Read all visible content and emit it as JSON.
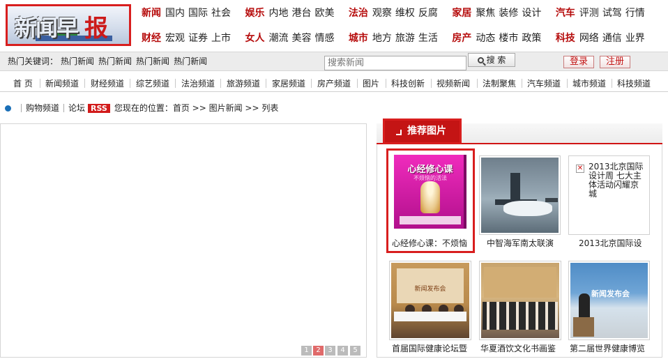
{
  "logo": {
    "text_a": "新闻早",
    "text_b": "报"
  },
  "nav_rows": [
    [
      {
        "cat": "新闻",
        "items": [
          "国内",
          "国际",
          "社会"
        ]
      },
      {
        "cat": "娱乐",
        "items": [
          "内地",
          "港台",
          "欧美"
        ]
      },
      {
        "cat": "法治",
        "items": [
          "观察",
          "维权",
          "反腐"
        ]
      },
      {
        "cat": "家居",
        "items": [
          "聚焦",
          "装修",
          "设计"
        ]
      },
      {
        "cat": "汽车",
        "items": [
          "评测",
          "试驾",
          "行情"
        ]
      }
    ],
    [
      {
        "cat": "财经",
        "items": [
          "宏观",
          "证券",
          "上市"
        ]
      },
      {
        "cat": "女人",
        "items": [
          "潮流",
          "美容",
          "情感"
        ]
      },
      {
        "cat": "城市",
        "items": [
          "地方",
          "旅游",
          "生活"
        ]
      },
      {
        "cat": "房产",
        "items": [
          "动态",
          "楼市",
          "政策"
        ]
      },
      {
        "cat": "科技",
        "items": [
          "网络",
          "通信",
          "业界"
        ]
      }
    ]
  ],
  "search": {
    "hot_label": "热门关键词：",
    "hot_keywords": [
      "热门新闻",
      "热门新闻",
      "热门新闻",
      "热门新闻"
    ],
    "placeholder": "搜索新闻",
    "button_label": "搜 索",
    "login_label": "登录",
    "register_label": "注册"
  },
  "channels": [
    "首 页",
    "新闻频道",
    "财经频道",
    "综艺频道",
    "法治频道",
    "旅游频道",
    "家居频道",
    "房产频道",
    "图片",
    "科技创新",
    "视频新闻",
    "法制聚焦",
    "汽车频道",
    "城市频道",
    "科技频道"
  ],
  "breadcrumb": {
    "shop_link": "购物频道",
    "forum_link": "论坛",
    "rss_label": "RSS",
    "location_text": "您现在的位置：首页 >> 图片新闻 >> 列表"
  },
  "pagination": [
    "1",
    "2",
    "3",
    "4",
    "5"
  ],
  "recommend": {
    "title": "推荐图片",
    "items": [
      {
        "caption": "心经修心课：不烦恼",
        "book_title": "心经修心课",
        "book_sub": "不烦恼的活法"
      },
      {
        "caption": "中智海军南太联演"
      },
      {
        "caption": "2013北京国际设",
        "alt_text": "2013北京国际设计周 七大主体活动闪耀京城"
      },
      {
        "caption": "首届国际健康论坛暨",
        "banner_text": "新闻发布会"
      },
      {
        "caption": "华夏酒饮文化书画鉴"
      },
      {
        "caption": "第二届世界健康博览",
        "banner_text": "新闻发布会"
      }
    ]
  }
}
